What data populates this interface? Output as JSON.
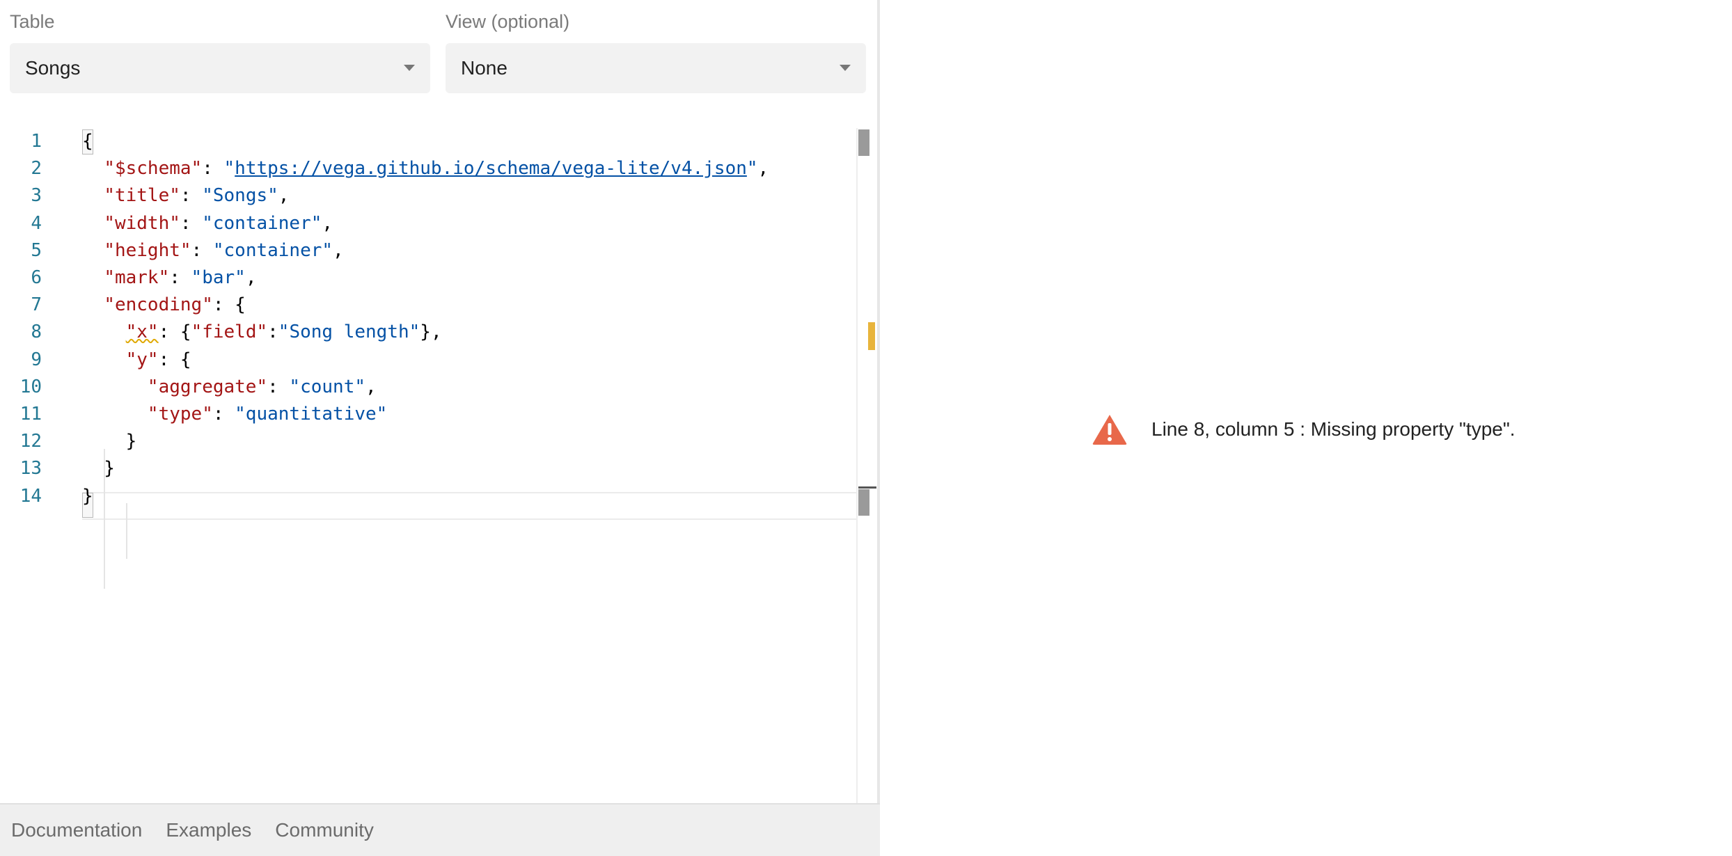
{
  "table_field": {
    "label": "Table",
    "value": "Songs"
  },
  "view_field": {
    "label": "View (optional)",
    "value": "None"
  },
  "editor": {
    "line_numbers": [
      "1",
      "2",
      "3",
      "4",
      "5",
      "6",
      "7",
      "8",
      "9",
      "10",
      "11",
      "12",
      "13",
      "14"
    ],
    "lines": [
      [
        {
          "t": "p",
          "v": "{"
        }
      ],
      [
        {
          "t": "p",
          "v": "  "
        },
        {
          "t": "k",
          "v": "\"$schema\""
        },
        {
          "t": "p",
          "v": ": "
        },
        {
          "t": "s",
          "v": "\""
        },
        {
          "t": "l",
          "v": "https://vega.github.io/schema/vega-lite/v4.json"
        },
        {
          "t": "s",
          "v": "\""
        },
        {
          "t": "p",
          "v": ","
        }
      ],
      [
        {
          "t": "p",
          "v": "  "
        },
        {
          "t": "k",
          "v": "\"title\""
        },
        {
          "t": "p",
          "v": ": "
        },
        {
          "t": "s",
          "v": "\"Songs\""
        },
        {
          "t": "p",
          "v": ","
        }
      ],
      [
        {
          "t": "p",
          "v": "  "
        },
        {
          "t": "k",
          "v": "\"width\""
        },
        {
          "t": "p",
          "v": ": "
        },
        {
          "t": "s",
          "v": "\"container\""
        },
        {
          "t": "p",
          "v": ","
        }
      ],
      [
        {
          "t": "p",
          "v": "  "
        },
        {
          "t": "k",
          "v": "\"height\""
        },
        {
          "t": "p",
          "v": ": "
        },
        {
          "t": "s",
          "v": "\"container\""
        },
        {
          "t": "p",
          "v": ","
        }
      ],
      [
        {
          "t": "p",
          "v": "  "
        },
        {
          "t": "k",
          "v": "\"mark\""
        },
        {
          "t": "p",
          "v": ": "
        },
        {
          "t": "s",
          "v": "\"bar\""
        },
        {
          "t": "p",
          "v": ","
        }
      ],
      [
        {
          "t": "p",
          "v": "  "
        },
        {
          "t": "k",
          "v": "\"encoding\""
        },
        {
          "t": "p",
          "v": ": {"
        }
      ],
      [
        {
          "t": "p",
          "v": "    "
        },
        {
          "t": "kw",
          "v": "\"x\""
        },
        {
          "t": "p",
          "v": ": {"
        },
        {
          "t": "k",
          "v": "\"field\""
        },
        {
          "t": "p",
          "v": ":"
        },
        {
          "t": "s",
          "v": "\"Song length\""
        },
        {
          "t": "p",
          "v": "},"
        }
      ],
      [
        {
          "t": "p",
          "v": "    "
        },
        {
          "t": "k",
          "v": "\"y\""
        },
        {
          "t": "p",
          "v": ": {"
        }
      ],
      [
        {
          "t": "p",
          "v": "      "
        },
        {
          "t": "k",
          "v": "\"aggregate\""
        },
        {
          "t": "p",
          "v": ": "
        },
        {
          "t": "s",
          "v": "\"count\""
        },
        {
          "t": "p",
          "v": ","
        }
      ],
      [
        {
          "t": "p",
          "v": "      "
        },
        {
          "t": "k",
          "v": "\"type\""
        },
        {
          "t": "p",
          "v": ": "
        },
        {
          "t": "s",
          "v": "\"quantitative\""
        }
      ],
      [
        {
          "t": "p",
          "v": "    }"
        }
      ],
      [
        {
          "t": "p",
          "v": "  }"
        }
      ],
      [
        {
          "t": "p",
          "v": "}"
        }
      ]
    ]
  },
  "footer": {
    "documentation": "Documentation",
    "examples": "Examples",
    "community": "Community"
  },
  "error": {
    "icon": "warning-triangle-icon",
    "color": "#e8684a",
    "message": "Line 8, column 5 : Missing property \"type\"."
  }
}
